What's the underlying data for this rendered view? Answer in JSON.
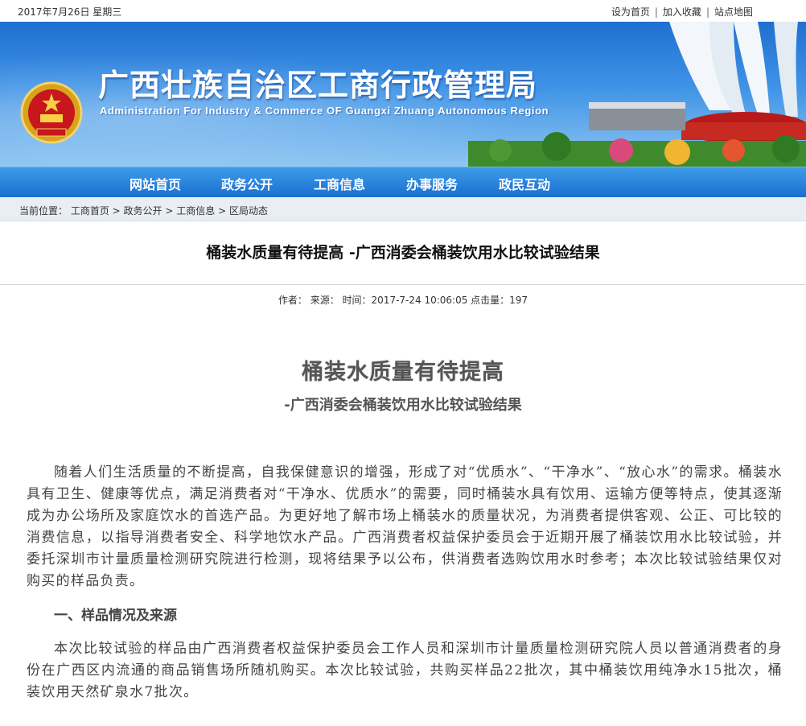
{
  "topbar": {
    "date": "2017年7月26日 星期三",
    "set_home": "设为首页",
    "add_fav": "加入收藏",
    "sitemap": "站点地图"
  },
  "header": {
    "title": "广西壮族自治区工商行政管理局",
    "subtitle": "Administration For Industry & Commerce OF Guangxi Zhuang Autonomous Region"
  },
  "nav": {
    "items": [
      "网站首页",
      "政务公开",
      "工商信息",
      "办事服务",
      "政民互动"
    ]
  },
  "breadcrumb": {
    "label": "当前位置：",
    "items": [
      "工商首页",
      "政务公开",
      "工商信息",
      "区局动态"
    ],
    "sep": " > "
  },
  "article": {
    "title": "桶装水质量有待提高 -广西消委会桶装饮用水比较试验结果",
    "meta": "作者：  来源：  时间：2017-7-24 10:06:05 点击量：197",
    "heading1": "桶装水质量有待提高",
    "heading2": "-广西消委会桶装饮用水比较试验结果",
    "para1": "随着人们生活质量的不断提高，自我保健意识的增强，形成了对“优质水”、“干净水”、“放心水”的需求。桶装水具有卫生、健康等优点，满足消费者对“干净水、优质水”的需要，同时桶装水具有饮用、运输方便等特点，使其逐渐成为办公场所及家庭饮水的首选产品。为更好地了解市场上桶装水的质量状况，为消费者提供客观、公正、可比较的消费信息，以指导消费者安全、科学地饮水产品。广西消费者权益保护委员会于近期开展了桶装饮用水比较试验，并委托深圳市计量质量检测研究院进行检测，现将结果予以公布，供消费者选购饮用水时参考；本次比较试验结果仅对购买的样品负责。",
    "section1": "一、样品情况及来源",
    "para2": "本次比较试验的样品由广西消费者权益保护委员会工作人员和深圳市计量质量检测研究院人员以普通消费者的身份在广西区内流通的商品销售场所随机购买。本次比较试验，共购买样品22批次，其中桶装饮用纯净水15批次，桶装饮用天然矿泉水7批次。"
  }
}
